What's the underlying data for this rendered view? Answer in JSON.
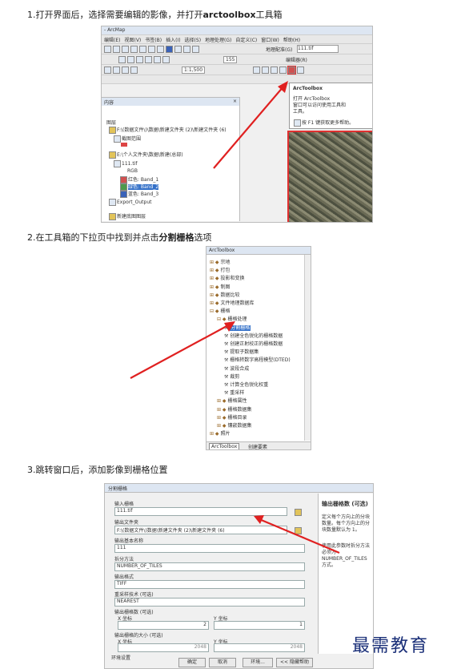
{
  "steps": {
    "s1_prefix": "1.打开界面后，选择需要编辑的影像，并打开",
    "s1_bold": "arctoolbox",
    "s1_suffix": "工具箱",
    "s2_prefix": "2.在工具箱的下拉页中找到并点击",
    "s2_bold": "分割栅格",
    "s2_suffix": "选项",
    "s3": "3.跳转窗口后，添加影像到栅格位置"
  },
  "shot1": {
    "title": "- ArcMap",
    "menu": [
      "编辑(E)",
      "视图(V)",
      "书签(B)",
      "插入(I)",
      "选择(S)",
      "地理处理(G)",
      "自定义(C)",
      "窗口(W)",
      "帮助(H)"
    ],
    "georef_label": "地理配准(G)",
    "georef_value": "111.tif",
    "editor_label": "编辑器(R)",
    "scale": "1:1,500",
    "scale2": "155",
    "toc_title": "内容",
    "layers_label": "图层",
    "folder1": "F:\\(数据文件\\)\\数据\\新建文件夹 (2)\\新建文件夹 (6)",
    "layer1": "截图范围",
    "folder2": "E:\\个人文件夹\\数据\\新建(总部)",
    "raster": "111.tif",
    "rgb": "RGB",
    "red": "红色: Band_1",
    "green": "绿色: Band_2",
    "blue": "蓝色: Band_3",
    "export": "Export_Output",
    "new_group": "新建底图图层",
    "tooltip_title": "ArcToolbox",
    "tooltip_body1": "打开 ArcToolbox",
    "tooltip_body2": "窗口可以访问使用工具和",
    "tooltip_body3": "工具。",
    "tooltip_help": "按 F1 键获取更多帮助。"
  },
  "shot2": {
    "title": "ArcToolbox",
    "items": [
      "宗地",
      "打包",
      "投影和变换",
      "制图",
      "数据比较",
      "文件地理数据库",
      "栅格",
      "栅格处理",
      "分割栅格",
      "创建全色锐化的栅格数据",
      "创建正射校正的栅格数据",
      "提取子数据集",
      "栅格转数字高程模型(DTED)",
      "波段合成",
      "裁剪",
      "计算全色锐化权重",
      "重采样",
      "栅格属性",
      "栅格数据集",
      "栅格目录",
      "镶嵌数据集",
      "照片"
    ],
    "tab_toolbox": "ArcToolbox",
    "tab_create": "创建要素"
  },
  "shot3": {
    "title": "分割栅格",
    "input_label": "输入栅格",
    "input_value": "111.tif",
    "output_folder_label": "输出文件夹",
    "output_folder_value": "F:\\(数据文件\\)数据\\新建文件夹 (2)\\新建文件夹 (6)",
    "prefix_label": "输出基本名称",
    "prefix_value": "111",
    "method_label": "拆分方法",
    "method_value": "NUMBER_OF_TILES",
    "format_label": "输出格式",
    "format_value": "TIFF",
    "resample_label": "重采样技术 (可选)",
    "resample_value": "NEAREST",
    "tiles_label": "输出栅格数 (可选)",
    "x_label": "X 坐标",
    "x_value": "2",
    "y_label": "Y 坐标",
    "y_value": "1",
    "cellsize_label": "输出栅格的大小 (可选)",
    "cs_x_label": "X 坐标",
    "cs_x_value": "2048",
    "cs_y_label": "Y 坐标",
    "cs_y_value": "2048",
    "env_label": "环境设置",
    "help_title": "输出栅格数 (可选)",
    "help_body": "定义每个方向上的分块数量。每个方向上的分块数量默认为 1。",
    "help_body2": "使用此参数时拆分方法必须为 NUMBER_OF_TILES 方式。",
    "btn_ok": "确定",
    "btn_cancel": "取消",
    "btn_env": "环境...",
    "btn_hide": "<< 隐藏帮助"
  },
  "watermark": "最需教育",
  "colors": {
    "arrow": "#e02020",
    "highlight": "#e03030",
    "watermark": "#1a2f78",
    "selected": "#3370c8"
  }
}
